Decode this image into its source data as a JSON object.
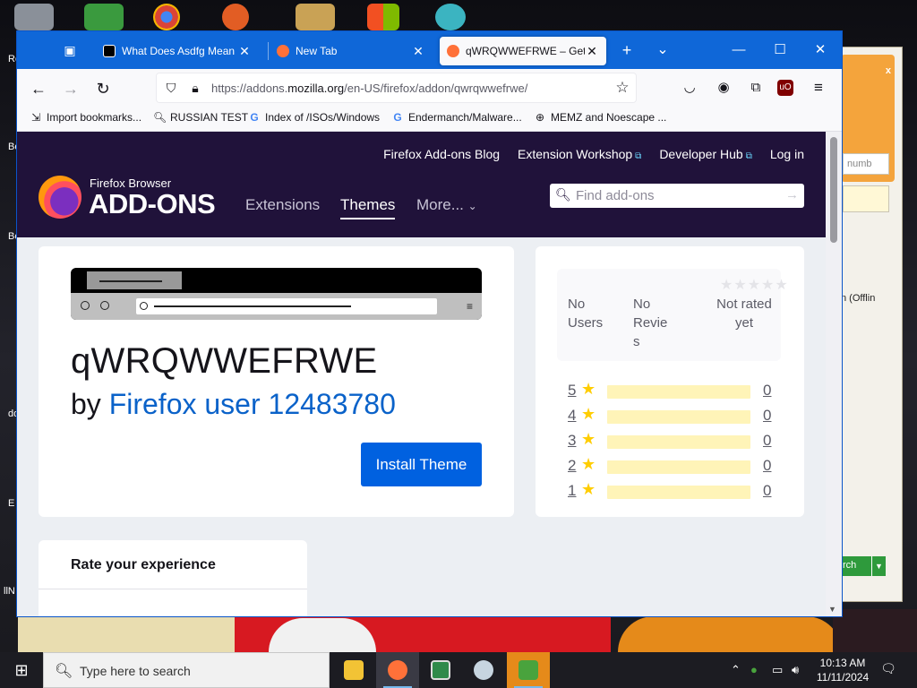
{
  "desktop": {
    "side_labels": [
      "Re",
      "Be",
      "Be",
      "do",
      "E",
      "llN"
    ],
    "background_window": {
      "close": "x",
      "number_placeholder": "numb",
      "offline": "n  (Offlin",
      "search_button": "rch"
    }
  },
  "browser": {
    "tabs": [
      {
        "label": "What Does Asdfg Mean |",
        "close": "✕",
        "favicon_color": "#000000"
      },
      {
        "label": "New Tab",
        "close": "✕",
        "favicon_color": "#ff7139"
      },
      {
        "label": "qWRQWWEFRWE – Get th",
        "close": "✕",
        "favicon_color": "#ff7139"
      }
    ],
    "new_tab": "+",
    "list_tabs": "⌄",
    "window_controls": {
      "minimize": "—",
      "maximize": "☐",
      "close": "✕"
    },
    "nav": {
      "back": "←",
      "forward": "→",
      "reload": "↻"
    },
    "url": {
      "prefix": "https://addons.",
      "domain": "mozilla.org",
      "path": "/en-US/firefox/addon/qwrqwwefrwe/"
    },
    "bookmarks": [
      {
        "label": "Import bookmarks...",
        "icon": "import-icon"
      },
      {
        "label": "RUSSIAN TEST",
        "icon": "search-icon"
      },
      {
        "label": "Index of /ISOs/Windows",
        "icon": "google-icon"
      },
      {
        "label": "Endermanch/Malware...",
        "icon": "google-icon"
      },
      {
        "label": "MEMZ and Noescape ...",
        "icon": "globe-icon"
      }
    ]
  },
  "amo": {
    "top_links": [
      "Firefox Add-ons Blog",
      "Extension Workshop",
      "Developer Hub",
      "Log in"
    ],
    "brand_small": "Firefox Browser",
    "brand_big": "ADD-ONS",
    "nav": [
      {
        "label": "Extensions",
        "active": false
      },
      {
        "label": "Themes",
        "active": true
      },
      {
        "label": "More...",
        "active": false
      }
    ],
    "search_placeholder": "Find add-ons",
    "addon": {
      "name": "qWRQWWEFRWE",
      "by": "by",
      "author": "Firefox user 12483780",
      "install_label": "Install Theme"
    },
    "stats": {
      "users_line1": "No",
      "users_line2": "Users",
      "reviews_line1": "No",
      "reviews_line2": "Revie",
      "reviews_line3": "s",
      "rating_line1": "Not rated",
      "rating_line2": "yet"
    },
    "rating_bars": [
      {
        "stars": "5",
        "count": "0",
        "fraction": 0
      },
      {
        "stars": "4",
        "count": "0",
        "fraction": 0
      },
      {
        "stars": "3",
        "count": "0",
        "fraction": 0
      },
      {
        "stars": "2",
        "count": "0",
        "fraction": 0
      },
      {
        "stars": "1",
        "count": "0",
        "fraction": 0
      }
    ],
    "rate_title": "Rate your experience"
  },
  "taskbar": {
    "search_placeholder": "Type here to search",
    "time": "10:13 AM",
    "date": "11/11/2024",
    "apps": [
      {
        "name": "file-explorer",
        "color": "#f2c335",
        "active": false
      },
      {
        "name": "firefox",
        "color": "#ff7139",
        "active": true
      },
      {
        "name": "app-window",
        "color": "#2f8a4a",
        "active": false
      },
      {
        "name": "steam",
        "color": "#1b2838",
        "active": false
      },
      {
        "name": "messenger",
        "color": "#49a33d",
        "active": true
      }
    ]
  }
}
